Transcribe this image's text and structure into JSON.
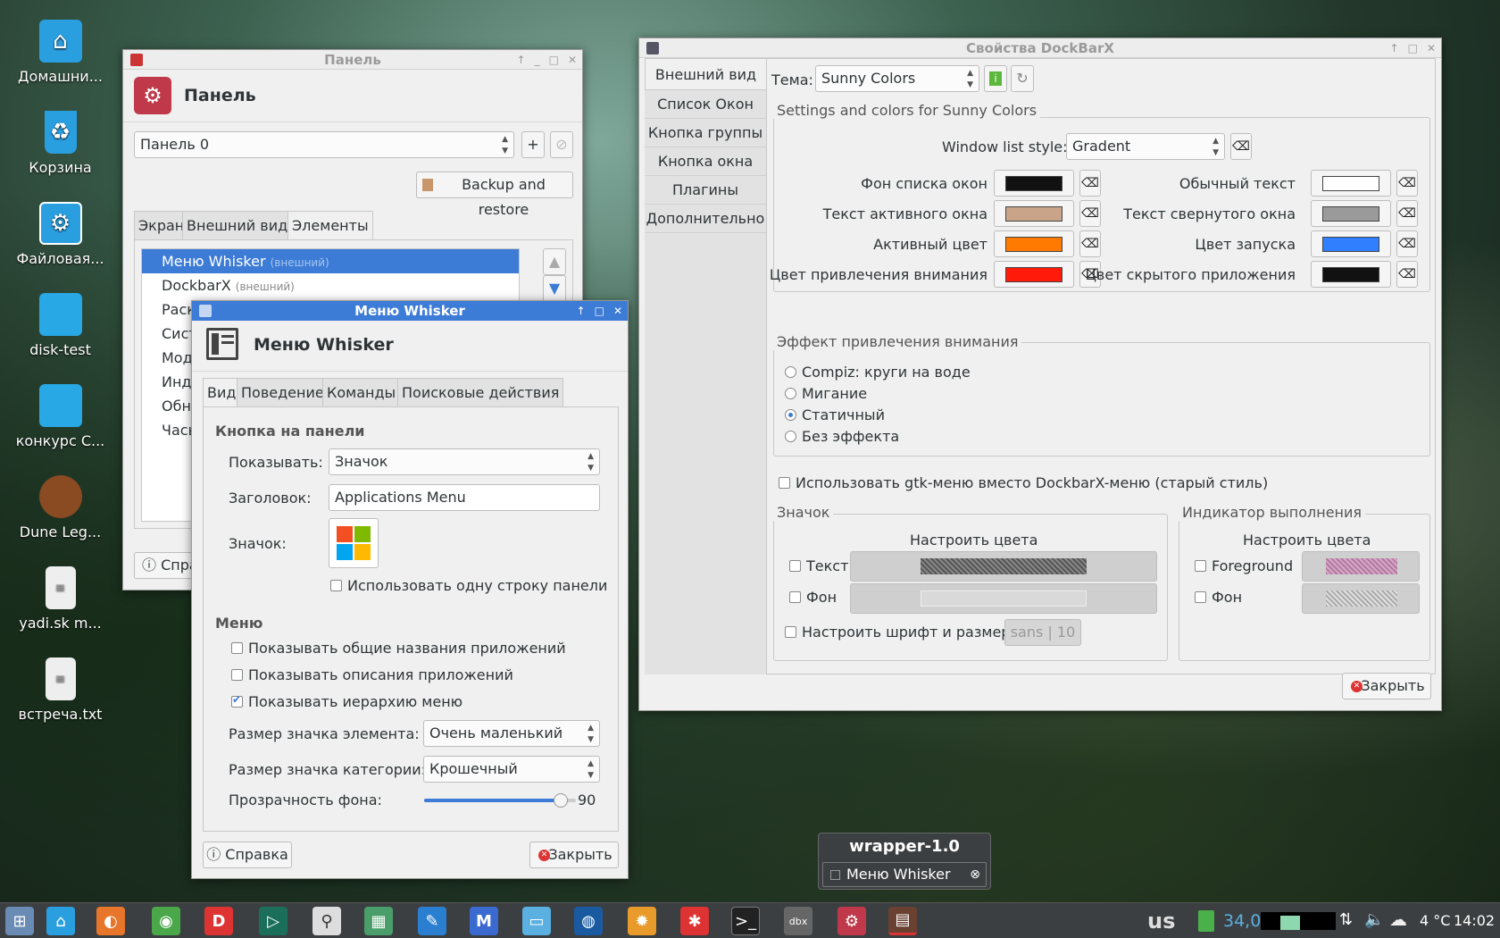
{
  "desktop": {
    "icons": [
      {
        "label": "Домашни...",
        "icon": "home-icon"
      },
      {
        "label": "Корзина",
        "icon": "trash-icon"
      },
      {
        "label": "Файловая...",
        "icon": "file-manager-icon"
      },
      {
        "label": "disk-test",
        "icon": "folder-icon"
      },
      {
        "label": "конкурс С...",
        "icon": "folder-icon"
      },
      {
        "label": "Dune Leg...",
        "icon": "game-icon"
      },
      {
        "label": "yadi.sk m...",
        "icon": "text-file-icon"
      },
      {
        "label": "встреча.txt",
        "icon": "text-file-icon"
      }
    ]
  },
  "panel_window": {
    "title": "Панель",
    "header": "Панель",
    "panel_select": "Панель 0",
    "add_label": "+",
    "backup_label": "Backup and restore",
    "tabs": [
      "Экран",
      "Внешний вид",
      "Элементы"
    ],
    "items": [
      {
        "name": "Меню Whisker",
        "note": "(внешний)"
      },
      {
        "name": "DockbarX",
        "note": "(внешний)"
      },
      {
        "name": "Раск",
        "note": ""
      },
      {
        "name": "Сист",
        "note": ""
      },
      {
        "name": "Мод",
        "note": ""
      },
      {
        "name": "Инд",
        "note": ""
      },
      {
        "name": "Обн",
        "note": ""
      },
      {
        "name": "Часы",
        "note": ""
      }
    ],
    "help_label": "Спра"
  },
  "whisker_window": {
    "title": "Меню Whisker",
    "header": "Меню Whisker",
    "tabs": [
      "Вид",
      "Поведение",
      "Команды",
      "Поисковые действия"
    ],
    "section_button": "Кнопка на панели",
    "show_label": "Показывать:",
    "show_value": "Значок",
    "heading_label": "Заголовок:",
    "heading_value": "Applications Menu",
    "icon_label": "Значок:",
    "single_row": "Использовать одну строку панели",
    "section_menu": "Меню",
    "opt_generic": "Показывать общие названия приложений",
    "opt_desc": "Показывать описания приложений",
    "opt_hierarchy": "Показывать иерархию меню",
    "item_icon_label": "Размер значка элемента:",
    "item_icon_value": "Очень маленький",
    "cat_icon_label": "Размер значка категории:",
    "cat_icon_value": "Крошечный",
    "opacity_label": "Прозрачность фона:",
    "opacity_value": "90",
    "opacity_fraction": 0.9,
    "help_label": "Справка",
    "close_label": "Закрыть"
  },
  "dockbarx_window": {
    "title": "Свойства DockBarX",
    "sidebar": [
      "Внешний вид",
      "Список Окон",
      "Кнопка группы",
      "Кнопка окна",
      "Плагины",
      "Дополнительно"
    ],
    "theme_label": "Тема:",
    "theme_value": "Sunny Colors",
    "settings_title": "Settings and colors for Sunny Colors",
    "wls_label": "Window list style:",
    "wls_value": "Gradent",
    "colors_left": [
      {
        "label": "Фон списка окон",
        "color": "#111111"
      },
      {
        "label": "Текст активного окна",
        "color": "#c9a488"
      },
      {
        "label": "Активный цвет",
        "color": "#ff7a00"
      },
      {
        "label": "Цвет привлечения внимания",
        "color": "#ff1a0a"
      }
    ],
    "colors_right": [
      {
        "label": "Обычный текст",
        "color": "#ffffff"
      },
      {
        "label": "Текст свернутого окна",
        "color": "#9a9a9a"
      },
      {
        "label": "Цвет запуска",
        "color": "#2f7fff"
      },
      {
        "label": "Цвет скрытого приложения",
        "color": "#111111"
      }
    ],
    "attention_title": "Эффект привлечения внимания",
    "attention_opts": [
      "Compiz: круги на воде",
      "Мигание",
      "Статичный",
      "Без эффекта"
    ],
    "gtk_menu": "Использовать gtk-меню вместо DockbarX-меню (старый стиль)",
    "icon_title": "Значок",
    "icon_customize": "Настроить цвета",
    "icon_text": "Текст",
    "icon_bg": "Фон",
    "font_label": "Настроить шрифт и размер",
    "font_name": "sans",
    "font_size": "10",
    "progress_title": "Индикатор выполнения",
    "progress_customize": "Настроить цвета",
    "progress_fg": "Foreground",
    "progress_bg": "Фон",
    "close_label": "Закрыть"
  },
  "tooltip": {
    "title": "wrapper-1.0",
    "item": "Меню Whisker"
  },
  "tray": {
    "layout": "us",
    "battery": "34,0",
    "temp": "4 °C",
    "time": "14:02"
  }
}
